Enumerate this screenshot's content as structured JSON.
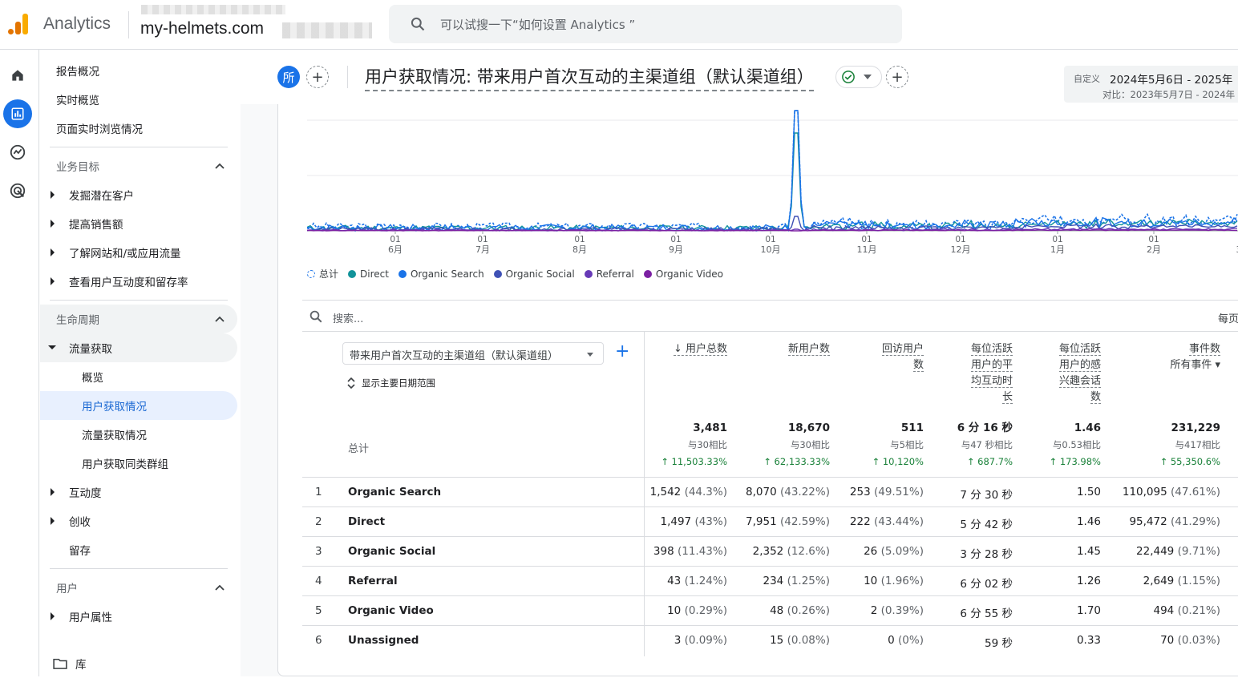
{
  "app": {
    "name": "Analytics",
    "property": "my-helmets.com"
  },
  "search": {
    "placeholder": "可以试搜一下“如何设置 Analytics ”"
  },
  "nav": {
    "top": [
      "报告概况",
      "实时概览",
      "页面实时浏览情况"
    ],
    "section_business": "业务目标",
    "business_items": [
      "发掘潜在客户",
      "提高销售额",
      "了解网站和/或应用流量",
      "查看用户互动度和留存率"
    ],
    "section_lifecycle": "生命周期",
    "acquisition": "流量获取",
    "acquisition_items": [
      "概览",
      "用户获取情况",
      "流量获取情况",
      "用户获取同类群组"
    ],
    "engagement": "互动度",
    "monetization": "创收",
    "retention": "留存",
    "section_user": "用户",
    "user_attributes": "用户属性",
    "library": "库"
  },
  "report": {
    "avatar_letter": "所",
    "title": "用户获取情况: 带来用户首次互动的主渠道组（默认渠道组）",
    "date_label": "自定义",
    "date_range": "2024年5月6日 - 2025年",
    "compare_range": "对比：2023年5月7日 - 2024年"
  },
  "chart_data": {
    "type": "line",
    "x_ticks": [
      {
        "day": "01",
        "month": "6月"
      },
      {
        "day": "01",
        "month": "7月"
      },
      {
        "day": "01",
        "month": "8月"
      },
      {
        "day": "01",
        "month": "9月"
      },
      {
        "day": "01",
        "month": "10月"
      },
      {
        "day": "01",
        "month": "11月"
      },
      {
        "day": "01",
        "month": "12月"
      },
      {
        "day": "01",
        "month": "1月"
      },
      {
        "day": "01",
        "month": "2月"
      },
      {
        "day": "",
        "month": "3"
      }
    ],
    "series": [
      {
        "name": "总计",
        "color": "#1a73e8",
        "dashed": true
      },
      {
        "name": "Direct",
        "color": "#12939a"
      },
      {
        "name": "Organic Search",
        "color": "#1a73e8"
      },
      {
        "name": "Organic Social",
        "color": "#3f51b5"
      },
      {
        "name": "Referral",
        "color": "#673ab7"
      },
      {
        "name": "Organic Video",
        "color": "#7b1fa2"
      }
    ],
    "peak_note": "spike shortly after 10月 01"
  },
  "table": {
    "search_placeholder": "搜索...",
    "per_page": "每页",
    "dimension": "带来用户首次互动的主渠道组（默认渠道组）",
    "show_range": "显示主要日期范围",
    "total_label": "总计",
    "columns": [
      {
        "lines": [
          "用户总数"
        ],
        "sorted": true
      },
      {
        "lines": [
          "新用户数"
        ]
      },
      {
        "lines": [
          "回访用户",
          "数"
        ]
      },
      {
        "lines": [
          "每位活跃",
          "用户的平",
          "均互动时",
          "长"
        ]
      },
      {
        "lines": [
          "每位活跃",
          "用户的感",
          "兴趣会话",
          "数"
        ]
      },
      {
        "lines": [
          "事件数",
          "所有事件"
        ]
      }
    ],
    "totals": [
      {
        "value": "3,481",
        "compare": "与30相比",
        "change": "↑ 11,503.33%"
      },
      {
        "value": "18,670",
        "compare": "与30相比",
        "change": "↑ 62,133.33%"
      },
      {
        "value": "511",
        "compare": "与5相比",
        "change": "↑ 10,120%"
      },
      {
        "value": "6 分 16 秒",
        "compare": "与47 秒相比",
        "change": "↑ 687.7%"
      },
      {
        "value": "1.46",
        "compare": "与0.53相比",
        "change": "↑ 173.98%"
      },
      {
        "value": "231,229",
        "compare": "与417相比",
        "change": "↑ 55,350.6%"
      }
    ],
    "rows": [
      {
        "idx": "1",
        "name": "Organic Search",
        "cells": [
          [
            "1,542",
            "(44.3%)"
          ],
          [
            "8,070",
            "(43.22%)"
          ],
          [
            "253",
            "(49.51%)"
          ],
          [
            "7 分 30 秒",
            ""
          ],
          [
            "1.50",
            ""
          ],
          [
            "110,095",
            "(47.61%)"
          ]
        ]
      },
      {
        "idx": "2",
        "name": "Direct",
        "cells": [
          [
            "1,497",
            "(43%)"
          ],
          [
            "7,951",
            "(42.59%)"
          ],
          [
            "222",
            "(43.44%)"
          ],
          [
            "5 分 42 秒",
            ""
          ],
          [
            "1.46",
            ""
          ],
          [
            "95,472",
            "(41.29%)"
          ]
        ]
      },
      {
        "idx": "3",
        "name": "Organic Social",
        "cells": [
          [
            "398",
            "(11.43%)"
          ],
          [
            "2,352",
            "(12.6%)"
          ],
          [
            "26",
            "(5.09%)"
          ],
          [
            "3 分 28 秒",
            ""
          ],
          [
            "1.45",
            ""
          ],
          [
            "22,449",
            "(9.71%)"
          ]
        ]
      },
      {
        "idx": "4",
        "name": "Referral",
        "cells": [
          [
            "43",
            "(1.24%)"
          ],
          [
            "234",
            "(1.25%)"
          ],
          [
            "10",
            "(1.96%)"
          ],
          [
            "6 分 02 秒",
            ""
          ],
          [
            "1.26",
            ""
          ],
          [
            "2,649",
            "(1.15%)"
          ]
        ]
      },
      {
        "idx": "5",
        "name": "Organic Video",
        "cells": [
          [
            "10",
            "(0.29%)"
          ],
          [
            "48",
            "(0.26%)"
          ],
          [
            "2",
            "(0.39%)"
          ],
          [
            "6 分 55 秒",
            ""
          ],
          [
            "1.70",
            ""
          ],
          [
            "494",
            "(0.21%)"
          ]
        ]
      },
      {
        "idx": "6",
        "name": "Unassigned",
        "cells": [
          [
            "3",
            "(0.09%)"
          ],
          [
            "15",
            "(0.08%)"
          ],
          [
            "0",
            "(0%)"
          ],
          [
            "59 秒",
            ""
          ],
          [
            "0.33",
            ""
          ],
          [
            "70",
            "(0.03%)"
          ]
        ]
      }
    ]
  }
}
